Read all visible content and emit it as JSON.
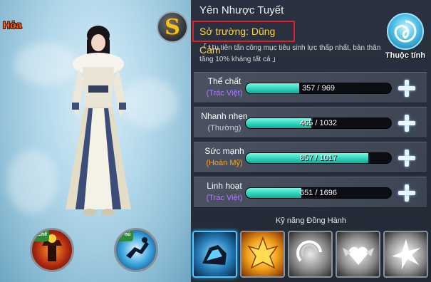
{
  "left": {
    "element_tag": "Hỏa",
    "s_badge": "S",
    "skill_slots": [
      {
        "tag": "K.Chế",
        "tag_color": "#2e8b3c",
        "icon": "fire-totem-icon"
      },
      {
        "tag": "T.Phú",
        "tag_color": "#2e8b3c",
        "icon": "dash-runner-icon"
      }
    ]
  },
  "header": {
    "name": "Yên Nhược Tuyết",
    "specialty": "Sở trường: Dũng Cảm",
    "description": "「 Ưu tiên tấn công mục tiêu sinh lực thấp nhất, bản thân tăng 10% kháng tất cả 」",
    "attribute_button": "Thuộc tính"
  },
  "stats": [
    {
      "name": "Thể chất",
      "grade": "(Trác Việt)",
      "grade_color": "#b07cff",
      "value": "357 / 969",
      "fill": 0.368
    },
    {
      "name": "Nhanh nhẹn",
      "grade": "(Thường)",
      "grade_color": "#c8c8c8",
      "value": "465 / 1032",
      "fill": 0.45
    },
    {
      "name": "Sức mạnh",
      "grade": "(Hoàn Mỹ)",
      "grade_color": "#ffa21a",
      "value": "857 / 1017",
      "fill": 0.843
    },
    {
      "name": "Linh hoạt",
      "grade": "(Trác Việt)",
      "grade_color": "#b07cff",
      "value": "651 / 1696",
      "fill": 0.384
    }
  ],
  "companion": {
    "title": "Kỹ năng Đồng Hành",
    "skills": [
      {
        "icon": "ice-rock-icon",
        "active": true
      },
      {
        "icon": "golden-flame-icon",
        "active": false
      },
      {
        "icon": "whirl-slash-icon",
        "active": false
      },
      {
        "icon": "winged-heart-icon",
        "active": false
      },
      {
        "icon": "star-burst-icon",
        "active": false
      }
    ]
  },
  "colors": {
    "accent": "#2fd7c0",
    "highlight_border": "#e0202a",
    "name_gold": "#ffd24a"
  }
}
